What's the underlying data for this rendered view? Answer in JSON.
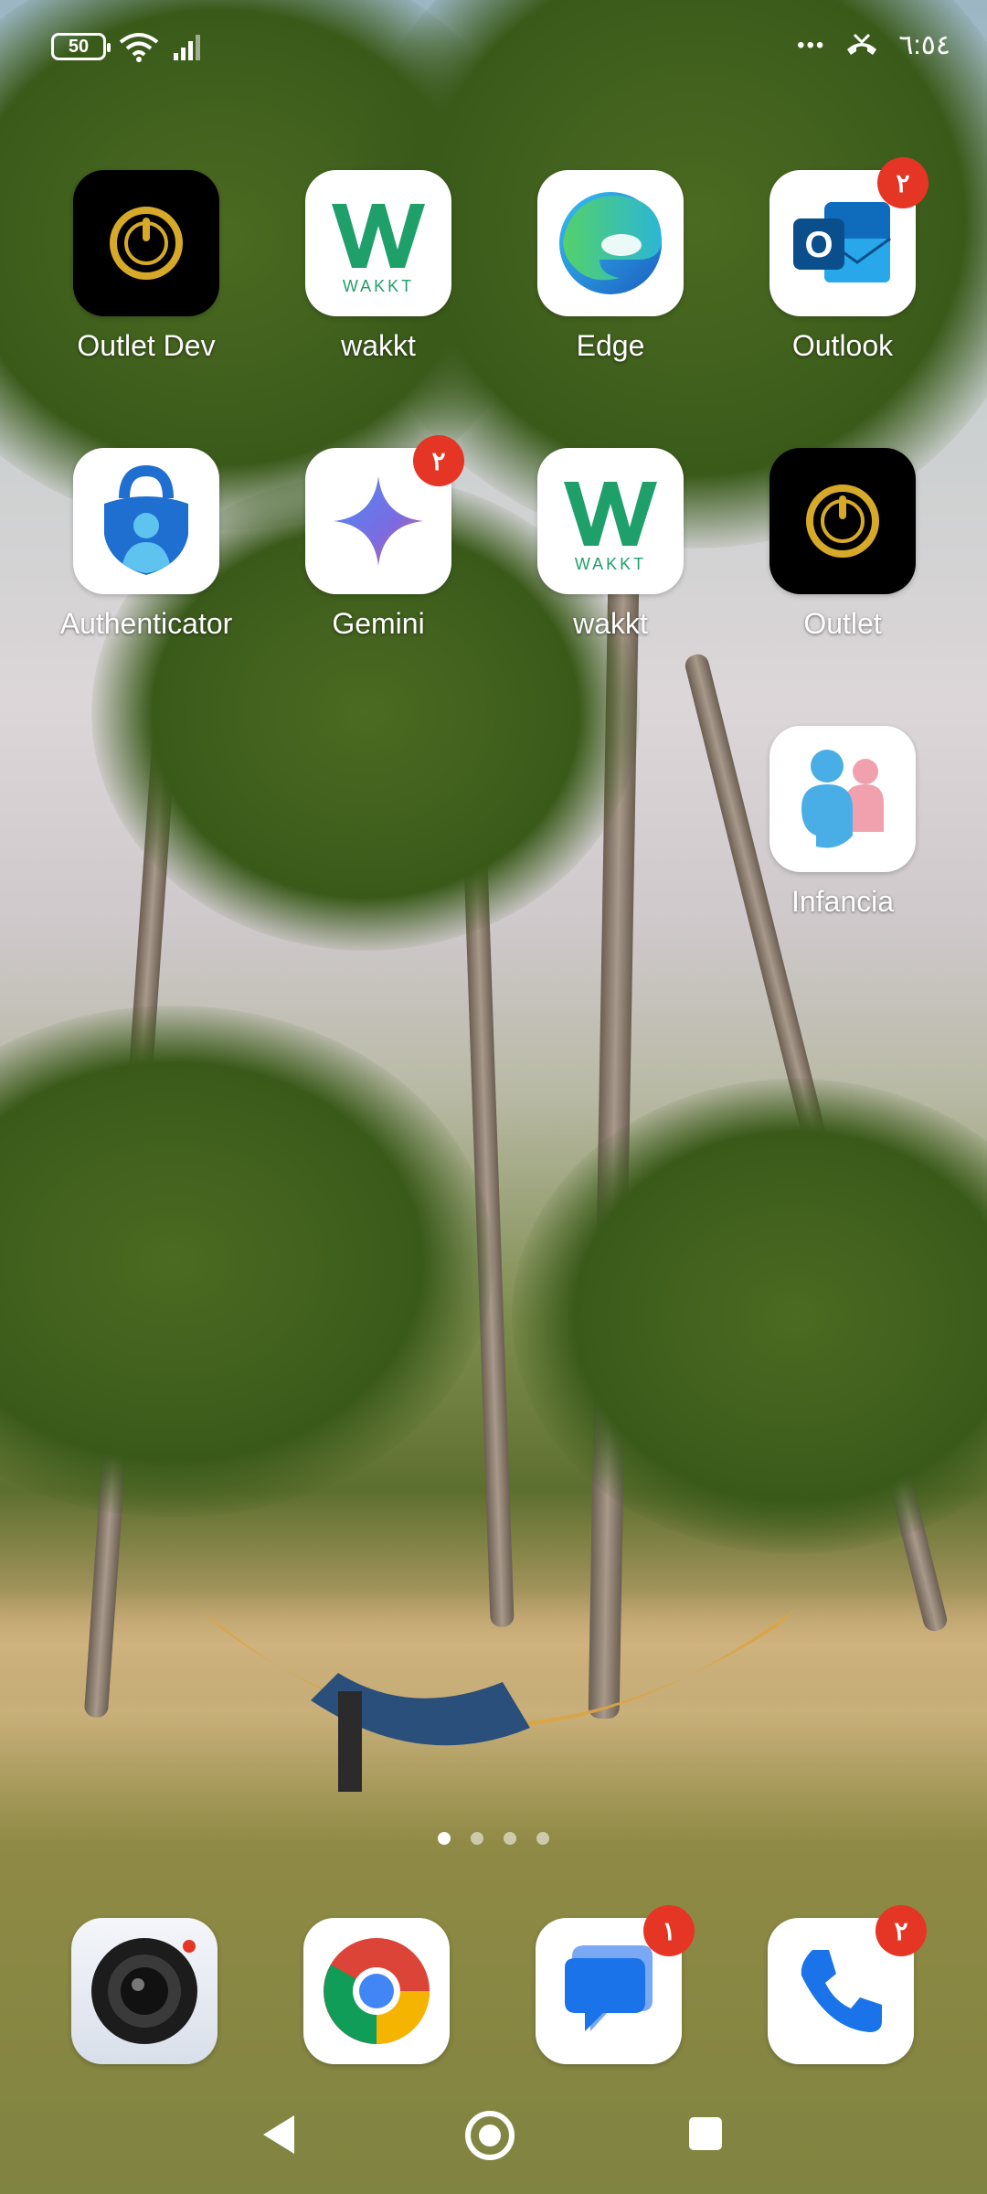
{
  "status": {
    "battery": "50",
    "time": "٦:٥٤",
    "more": "•••"
  },
  "apps": [
    {
      "name": "Outlet Dev",
      "icon": "power-ring-icon",
      "badge": ""
    },
    {
      "name": "wakkt",
      "icon": "wakkt-logo-icon",
      "badge": ""
    },
    {
      "name": "Edge",
      "icon": "edge-logo-icon",
      "badge": ""
    },
    {
      "name": "Outlook",
      "icon": "outlook-logo-icon",
      "badge": "٢"
    },
    {
      "name": "Authenticator",
      "icon": "authenticator-lock-icon",
      "badge": ""
    },
    {
      "name": "Gemini",
      "icon": "gemini-sparkle-icon",
      "badge": "٢"
    },
    {
      "name": "wakkt",
      "icon": "wakkt-logo-icon",
      "badge": ""
    },
    {
      "name": "Outlet",
      "icon": "power-ring-icon",
      "badge": ""
    },
    {
      "name": "Infancia",
      "icon": "infancia-people-icon",
      "badge": ""
    }
  ],
  "wakkt_logo_text": "WAKKT",
  "outlook_letter": "O",
  "dock": [
    {
      "icon": "camera-icon",
      "badge": ""
    },
    {
      "icon": "chrome-logo-icon",
      "badge": ""
    },
    {
      "icon": "messages-bubble-icon",
      "badge": "١"
    },
    {
      "icon": "phone-handset-icon",
      "badge": "٢"
    }
  ],
  "pages": {
    "count": 4,
    "active": 1
  },
  "colors": {
    "badge": "#e53525",
    "wakkt_green": "#1fa06a",
    "outlet_gold": "#d6a928"
  }
}
